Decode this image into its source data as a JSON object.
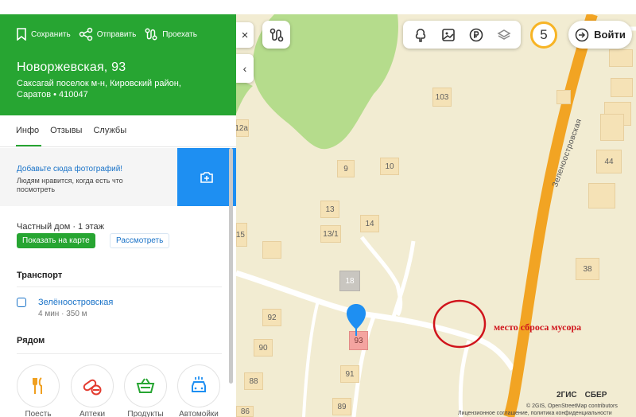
{
  "panel": {
    "actions": [
      {
        "label": "Сохранить",
        "icon": "bookmark-icon"
      },
      {
        "label": "Отправить",
        "icon": "share-icon"
      },
      {
        "label": "Проехать",
        "icon": "route-icon"
      }
    ],
    "title": "Новоржевская, 93",
    "address": "Саксагай поселок м-н, Кировский район, Саратов • 410047",
    "tabs": [
      "Инфо",
      "Отзывы",
      "Службы"
    ],
    "photo_prompt": {
      "link": "Добавьте сюда фотографий!",
      "text": "Людям нравится, когда есть что посмотреть"
    },
    "house_info": "Частный дом · 1 этаж",
    "show_on_map": "Показать на карте",
    "view": "Рассмотреть",
    "transport": {
      "title": "Транспорт",
      "stop_name": "Зелёноостровская",
      "stop_time": "4 мин · 350 м"
    },
    "nearby": {
      "title": "Рядом",
      "items": [
        "Поесть",
        "Аптеки",
        "Продукты",
        "Автомойки"
      ]
    },
    "accent_color": "#27a532"
  },
  "map": {
    "controls": {
      "close": "×",
      "collapse": "‹",
      "counter": "5",
      "login": "Войти"
    },
    "street_name": "Зеленоостровская",
    "houses": [
      "103",
      "9",
      "10",
      "13",
      "14",
      "13/1",
      "15",
      "18",
      "92",
      "93",
      "90",
      "91",
      "88",
      "89",
      "86",
      "38",
      "44",
      "12а"
    ],
    "annotation": "место сброса мусора",
    "copyright": "© 2GIS, OpenStreetMap contributors",
    "license": "Лицензионное соглашение, политика конфиденциальности",
    "logos": [
      "2ГИС",
      "СБЕР"
    ]
  }
}
